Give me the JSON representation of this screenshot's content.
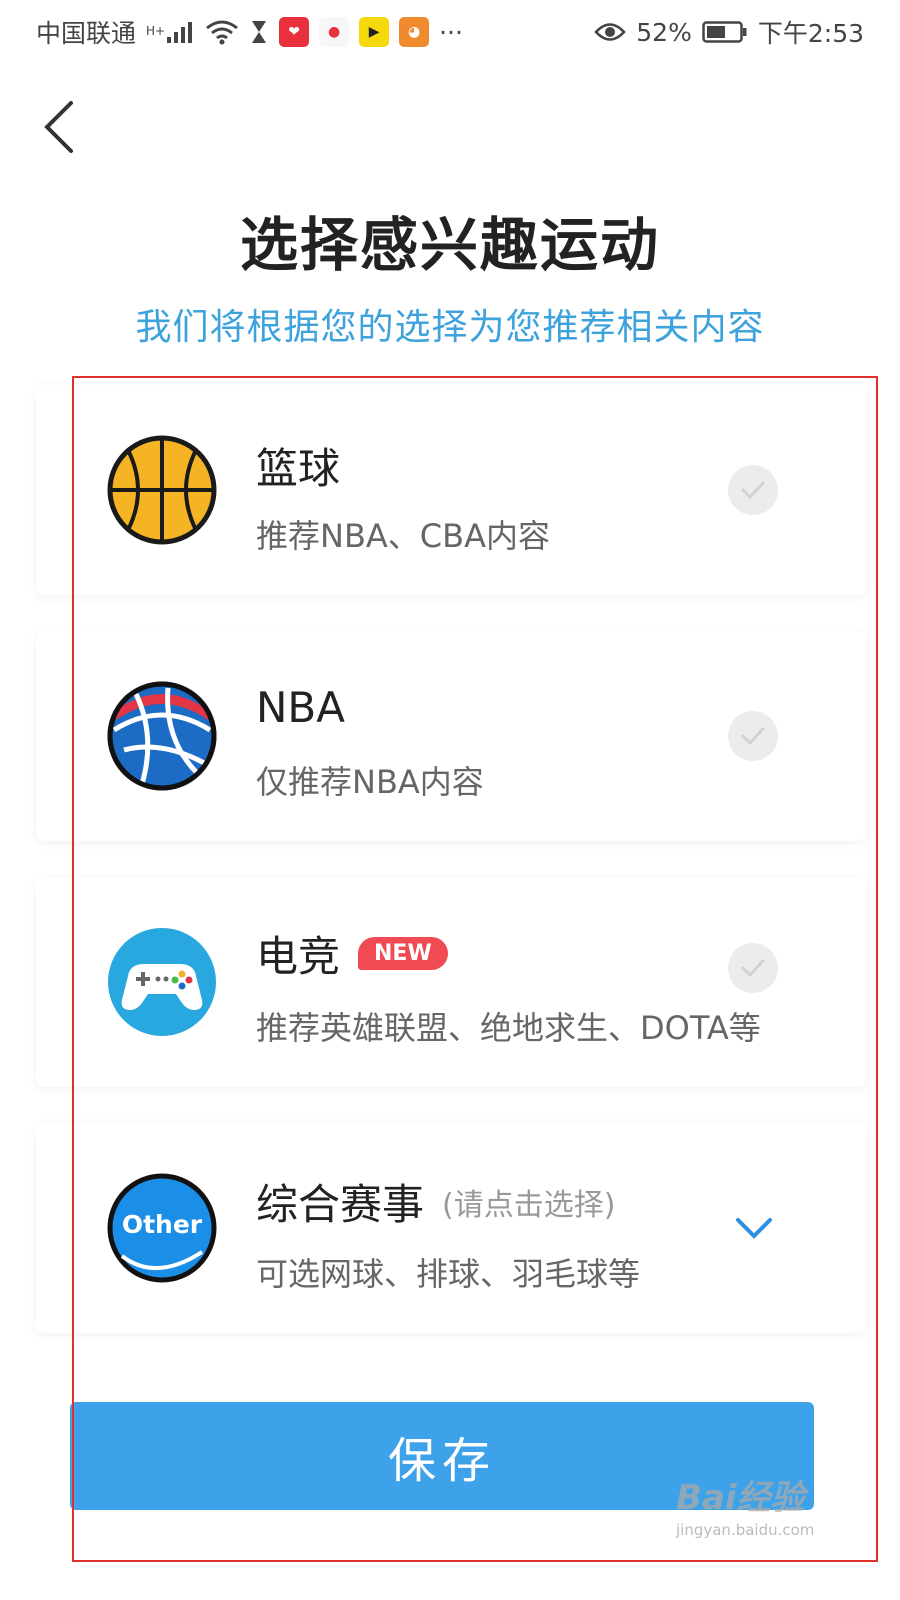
{
  "status_bar": {
    "carrier": "中国联通",
    "network": "H+",
    "battery": "52%",
    "time": "下午2:53",
    "more": "···"
  },
  "header": {
    "title": "选择感兴趣运动",
    "subtitle": "我们将根据您的选择为您推荐相关内容"
  },
  "sports": [
    {
      "name": "篮球",
      "desc": "推荐NBA、CBA内容",
      "icon": "basketball-icon",
      "selected": false
    },
    {
      "name": "NBA",
      "desc": "仅推荐NBA内容",
      "icon": "nba-ball-icon",
      "selected": false
    },
    {
      "name": "电竞",
      "badge": "NEW",
      "desc": "推荐英雄联盟、绝地求生、DOTA等",
      "icon": "gamepad-icon",
      "selected": false
    },
    {
      "name": "综合赛事",
      "hint": "(请点击选择)",
      "desc": "可选网球、排球、羽毛球等",
      "icon_text": "Other",
      "icon": "other-icon",
      "expandable": true
    }
  ],
  "save_label": "保存",
  "watermark": {
    "main": "Bai经验",
    "sub": "jingyan.baidu.com"
  },
  "colors": {
    "accent": "#3da2ea",
    "subtitle": "#3ea2dc",
    "badge": "#f04a52",
    "frame": "#e0312c"
  }
}
